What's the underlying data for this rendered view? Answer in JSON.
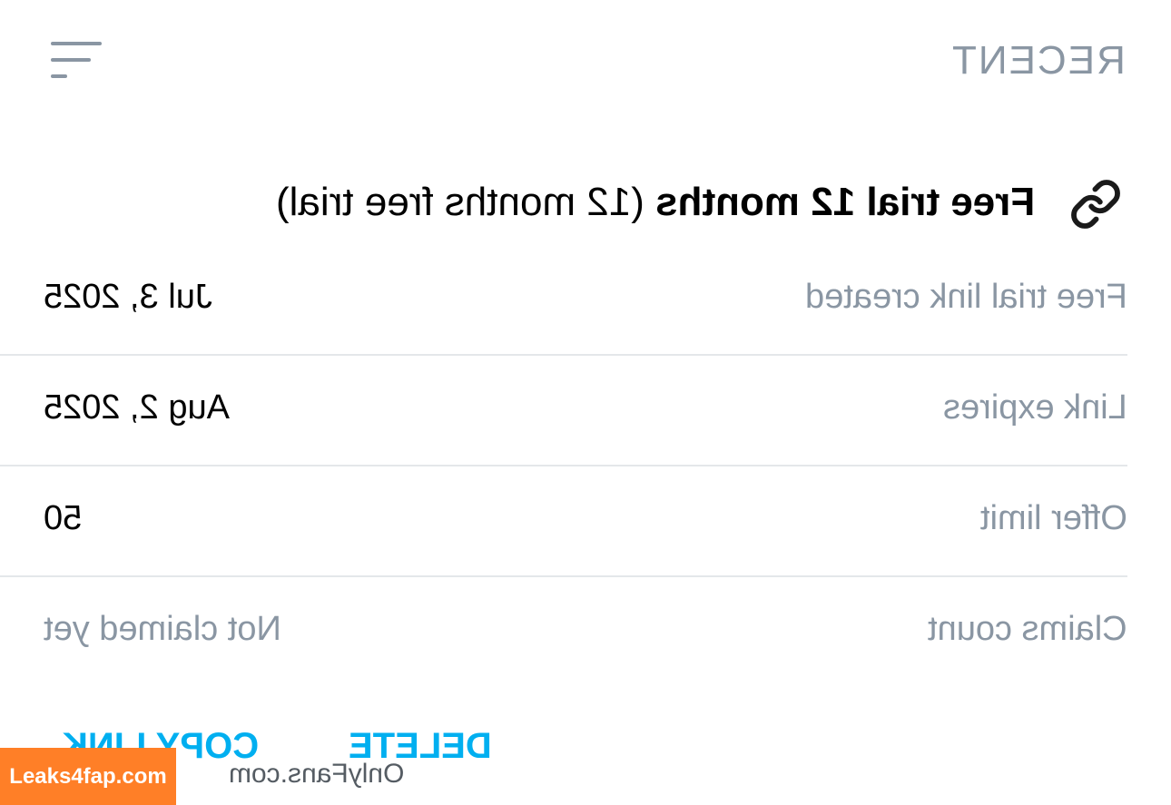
{
  "header": {
    "title": "RECENT",
    "sort_icon": "sort-lines-icon"
  },
  "link": {
    "icon": "link-icon",
    "title_bold": "Free trial 12 months",
    "title_rest": " (12 months free trial)"
  },
  "details": [
    {
      "label": "Free trial link created",
      "value": "Jul 3, 2025"
    },
    {
      "label": "Link expires",
      "value": "Aug 2, 2025"
    },
    {
      "label": "Offer limit",
      "value": "50"
    },
    {
      "label": "Claims count",
      "value": "Not claimed yet"
    }
  ],
  "actions": {
    "delete_label": "DELETE",
    "copy_label": "COPY LINK"
  },
  "watermark": {
    "badge": "Leaks4fap.com",
    "site": "OnlyFans.com"
  },
  "colors": {
    "accent": "#00aff0",
    "muted": "#8a96a3",
    "divider": "#e4e7ea",
    "badge": "#ff7f27"
  }
}
